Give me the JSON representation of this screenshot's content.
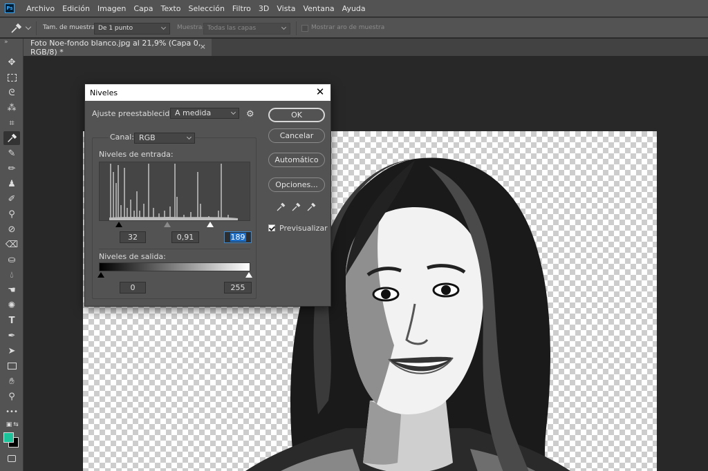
{
  "app": {
    "logo_text": "Ps",
    "accent_color": "#31a8ff"
  },
  "menubar": {
    "items": [
      "Archivo",
      "Edición",
      "Imagen",
      "Capa",
      "Texto",
      "Selección",
      "Filtro",
      "3D",
      "Vista",
      "Ventana",
      "Ayuda"
    ]
  },
  "options": {
    "tool_icon": "eyedropper-icon",
    "sample_size_label": "Tam. de muestra:",
    "sample_size_value": "De 1 punto",
    "sample_label": "Muestra:",
    "sample_value": "Todas las capas",
    "show_ring_label": "Mostrar aro de muestra",
    "show_ring_checked": false
  },
  "document_tab": {
    "title": "Foto Noe-fondo blanco.jpg al 21,9% (Capa 0, RGB/8) *",
    "close": "×"
  },
  "toolbar": {
    "active_tool": "eyedropper",
    "foreground_color": "#1bc29a",
    "background_color": "#000000",
    "more_label": "•••"
  },
  "dialog": {
    "title": "Niveles",
    "close": "✕",
    "preset_label": "Ajuste preestablecido:",
    "preset_value": "A medida",
    "channel_label": "Canal:",
    "channel_value": "RGB",
    "input_label": "Niveles de entrada:",
    "input_black": "32",
    "input_gamma": "0,91",
    "input_white": "189",
    "output_label": "Niveles de salida:",
    "output_black": "0",
    "output_white": "255",
    "buttons": {
      "ok": "OK",
      "cancel": "Cancelar",
      "auto": "Automático",
      "options": "Opciones..."
    },
    "preview_label": "Previsualizar",
    "preview_checked": true
  }
}
